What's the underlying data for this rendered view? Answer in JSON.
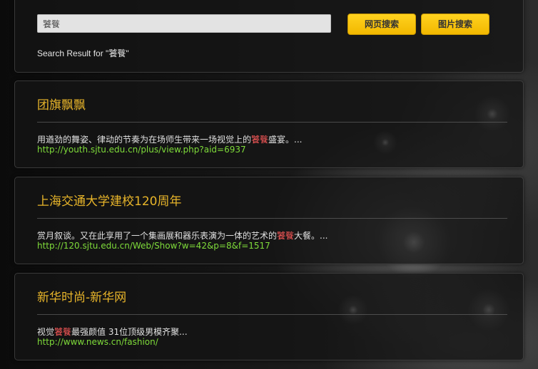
{
  "search": {
    "query": "饕餮",
    "web_button_label": "网页搜索",
    "image_button_label": "图片搜索",
    "result_label_prefix": "Search Result for \"",
    "result_label_query": "饕餮",
    "result_label_suffix": "\""
  },
  "results": [
    {
      "title": "团旗飘飘",
      "snippet_before": "用遒劲的舞姿、律动的节奏为在场师生带来一场视觉上的",
      "snippet_highlight": "饕餮",
      "snippet_after": "盛宴。...",
      "url": "http://youth.sjtu.edu.cn/plus/view.php?aid=6937"
    },
    {
      "title": "上海交通大学建校120周年",
      "snippet_before": "赏月叙谈。又在此享用了一个集画展和器乐表演为一体的艺术的",
      "snippet_highlight": "饕餮",
      "snippet_after": "大餐。...",
      "url": "http://120.sjtu.edu.cn/Web/Show?w=42&p=8&f=1517"
    },
    {
      "title": "新华时尚-新华网",
      "snippet_before": "视觉",
      "snippet_highlight": "饕餮",
      "snippet_after": "最强颜值 31位顶级男模齐聚...",
      "url": "http://www.news.cn/fashion/"
    }
  ],
  "colors": {
    "title": "#e8b52a",
    "highlight": "#ff5a5a",
    "url": "#7fdc3a",
    "button": "#ffc800"
  }
}
